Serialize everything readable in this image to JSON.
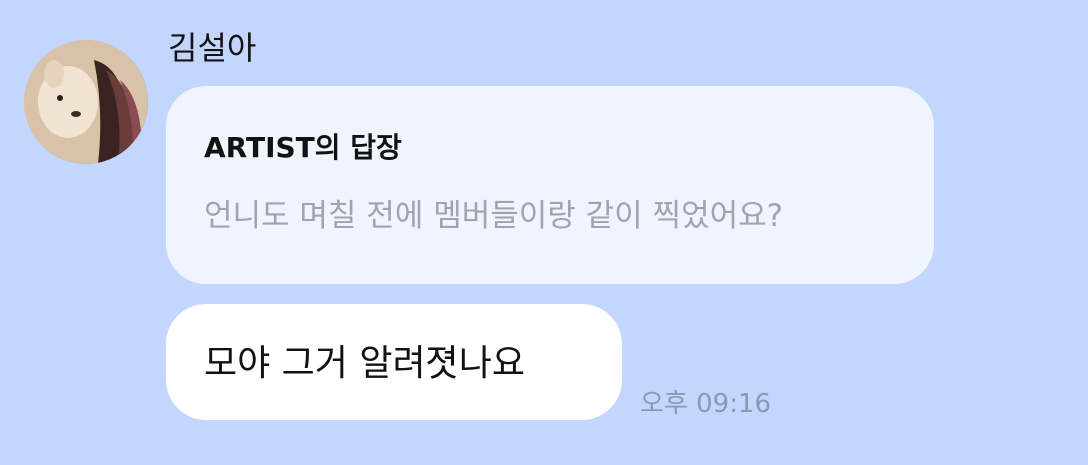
{
  "chat": {
    "sender_name": "김설아",
    "avatar_icon": "profile-photo-puppy",
    "reply": {
      "title": "ARTIST의 답장",
      "quoted_text": "언니도 며칠 전에 멤버들이랑 같이 찍었어요?"
    },
    "message": {
      "text": "모야 그거 알려졋나요",
      "time": "오후 09:16"
    }
  },
  "colors": {
    "background": "#c3d6ff",
    "reply_bubble": "#eff4ff",
    "message_bubble": "#ffffff",
    "quoted_text": "#a0a4ad",
    "timestamp": "#8b98b0"
  }
}
